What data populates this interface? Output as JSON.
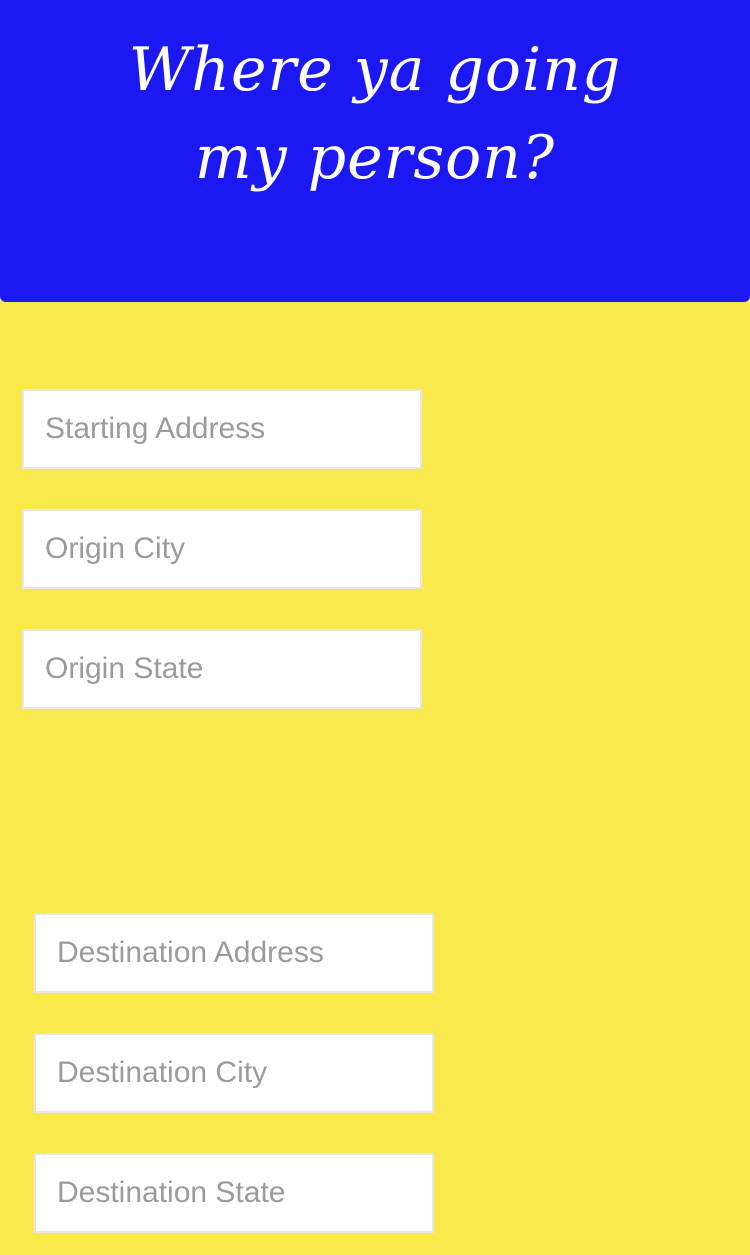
{
  "header": {
    "title": "Where ya going my person?",
    "background_color": "#1c18f4",
    "text_color": "#ffffff"
  },
  "page": {
    "background_color": "#f9e94c"
  },
  "origin": {
    "address_placeholder": "Starting Address",
    "city_placeholder": "Origin City",
    "state_placeholder": "Origin State"
  },
  "destination": {
    "address_placeholder": "Destination Address",
    "city_placeholder": "Destination City",
    "state_placeholder": "Destination State"
  }
}
